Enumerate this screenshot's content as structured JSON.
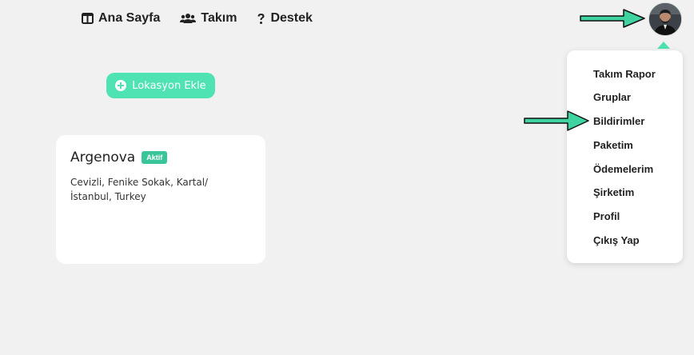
{
  "nav": {
    "items": [
      {
        "label": "Ana Sayfa",
        "icon": "columns-icon"
      },
      {
        "label": "Takım",
        "icon": "users-icon"
      },
      {
        "label": "Destek",
        "icon": "question-icon"
      }
    ]
  },
  "user_menu": {
    "items": [
      {
        "label": "Takım Rapor"
      },
      {
        "label": "Gruplar"
      },
      {
        "label": "Bildirimler"
      },
      {
        "label": "Paketim"
      },
      {
        "label": "Ödemelerim"
      },
      {
        "label": "Şirketim"
      },
      {
        "label": "Profil"
      },
      {
        "label": "Çıkış Yap"
      }
    ]
  },
  "actions": {
    "add_location_label": "Lokasyon Ekle"
  },
  "location_card": {
    "name": "Argenova",
    "status": "Aktif",
    "address": "Cevizli, Fenike Sokak, Kartal/İstanbul, Turkey"
  },
  "colors": {
    "accent": "#4fe3b3",
    "badge": "#3ac49a",
    "background": "#f1f1f1"
  }
}
